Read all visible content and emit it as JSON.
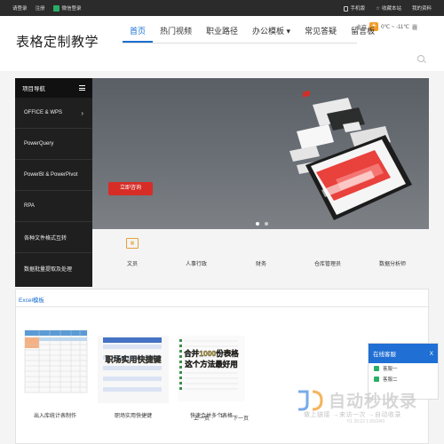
{
  "topbar": {
    "links": [
      "请登录",
      "注册",
      "微信登录"
    ],
    "right": [
      "手机版",
      "收藏本站",
      "我的资料"
    ]
  },
  "header": {
    "logo": "表格定制教学",
    "weather_city": "北京",
    "weather_temp": "0℃ ~ -11℃",
    "weather_extra": "霾",
    "nav": [
      {
        "label": "首页",
        "active": true
      },
      {
        "label": "热门视频"
      },
      {
        "label": "职业路径"
      },
      {
        "label": "办公模板 ▾"
      },
      {
        "label": "常见答疑"
      },
      {
        "label": "留言板"
      }
    ]
  },
  "sidebar": {
    "title": "项目导航",
    "items": [
      "OFFICE & WPS",
      "PowerQuery",
      "PowerBI & PowerPivot",
      "RPA",
      "各种文件格式互转",
      "数据批量提取及处理"
    ]
  },
  "banner": {
    "cta": "立即咨询"
  },
  "categories": [
    "文员",
    "人事行政",
    "财务",
    "仓库管理员",
    "数据分析师"
  ],
  "module": {
    "title": "Excel模板",
    "thumbs": [
      {
        "caption": "出入库统计表制作",
        "overlay": ""
      },
      {
        "caption": "职场实用快捷键",
        "overlay": "职场实用快捷键"
      },
      {
        "caption": "快速合并多个表格",
        "overlay": "合并1000份表格",
        "overlay2": "这个方法最好用"
      }
    ],
    "pager": {
      "prev": "上一页",
      "page": "1",
      "next": "下一页"
    }
  },
  "service": {
    "title": "在线客服",
    "close": "X",
    "rows": [
      "客服一",
      "客服二"
    ]
  },
  "watermark": {
    "big": "自动秒收录",
    "small": "做上链接 →来访一次 →自动收录",
    "tail": "7/1 20:22 1.00/24/0"
  },
  "colors": {
    "accent": "#1a6fd1",
    "cta": "#d62d27",
    "service": "#1f6fd4"
  }
}
